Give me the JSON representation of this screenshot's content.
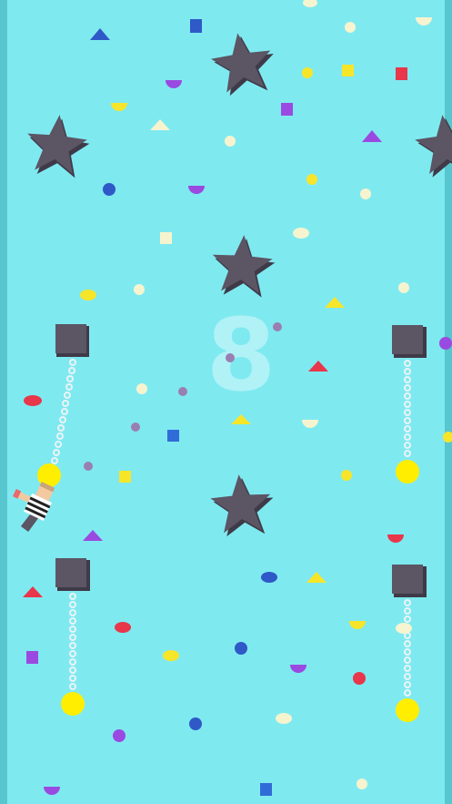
{
  "hud": {
    "score": "8"
  },
  "colors": {
    "background": "#7fe9f0",
    "wall": "#58c6cf",
    "anchor": "#5b5564",
    "ring": "#ffee00",
    "star": "#5b5564",
    "chain": "#e9f4f6"
  },
  "icons": {
    "anchor": "square-anchor-block",
    "ring": "yellow-ring",
    "star": "star-obstacle",
    "player": "striped-prisoner-character"
  }
}
